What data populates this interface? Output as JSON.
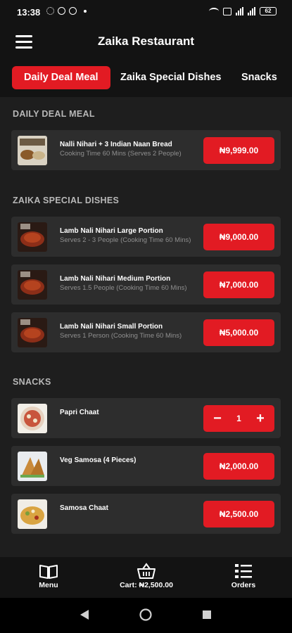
{
  "status_bar": {
    "time": "13:38",
    "battery": "62"
  },
  "header": {
    "title": "Zaika Restaurant"
  },
  "tabs": [
    {
      "label": "Daily Deal Meal"
    },
    {
      "label": "Zaika Special Dishes"
    },
    {
      "label": "Snacks"
    }
  ],
  "sections": {
    "daily": {
      "title": "DAILY DEAL MEAL"
    },
    "special": {
      "title": "ZAIKA SPECIAL DISHES"
    },
    "snacks": {
      "title": "SNACKS"
    }
  },
  "items": [
    {
      "name": "Nalli Nihari + 3 Indian Naan Bread",
      "desc": "Cooking Time 60 Mins (Serves 2 People)",
      "price": "₦9,999.00"
    },
    {
      "name": "Lamb Nali Nihari Large Portion",
      "desc": "Serves 2 - 3 People (Cooking Time 60 Mins)",
      "price": "₦9,000.00"
    },
    {
      "name": "Lamb Nali Nihari Medium Portion",
      "desc": "Serves 1.5 People (Cooking Time 60 Mins)",
      "price": "₦7,000.00"
    },
    {
      "name": "Lamb Nali Nihari Small Portion",
      "desc": "Serves 1 Person (Cooking Time 60 Mins)",
      "price": "₦5,000.00"
    },
    {
      "name": "Papri Chaat",
      "desc": "",
      "quantity": "1",
      "minus": "−",
      "plus": "+"
    },
    {
      "name": "Veg Samosa (4 Pieces)",
      "desc": "",
      "price": "₦2,000.00"
    },
    {
      "name": "Samosa Chaat",
      "desc": "",
      "price": "₦2,500.00"
    }
  ],
  "bottom_nav": {
    "menu": "Menu",
    "cart": "Cart: ₦2,500.00",
    "orders": "Orders"
  },
  "colors": {
    "accent": "#e21b23",
    "background": "#1e1e1e",
    "card": "#2d2d2d",
    "bar": "#131313"
  },
  "icons": [
    "menu-icon",
    "book-icon",
    "basket-icon",
    "list-icon",
    "back-icon",
    "home-icon",
    "recents-icon"
  ]
}
